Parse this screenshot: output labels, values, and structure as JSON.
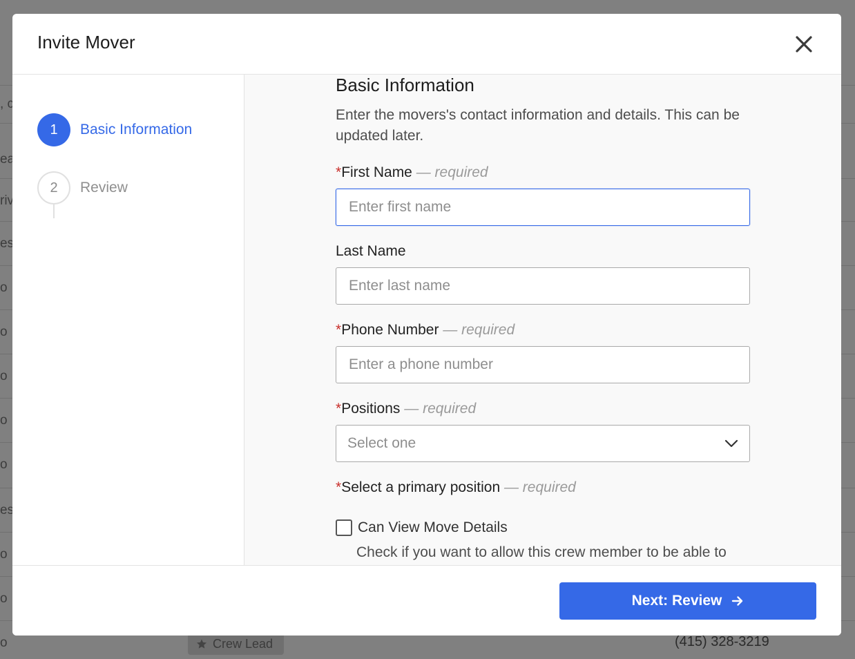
{
  "background": {
    "edge_fragments": [
      ", c",
      "ea",
      "riv",
      "es",
      "o",
      "o",
      "o",
      "o",
      "o",
      "es",
      "o",
      "o",
      "o"
    ],
    "badge_label": "Crew Lead",
    "badge_icon": "star-icon",
    "phone": "(415) 328-3219"
  },
  "modal": {
    "title": "Invite Mover",
    "close_icon": "close-icon"
  },
  "steps": [
    {
      "number": "1",
      "label": "Basic Information",
      "state": "active"
    },
    {
      "number": "2",
      "label": "Review",
      "state": "inactive"
    }
  ],
  "form": {
    "section_title": "Basic Information",
    "section_description": "Enter the movers's contact information and details. This can be updated later.",
    "required_note": "— required",
    "first_name": {
      "label": "First Name",
      "placeholder": "Enter first name",
      "value": ""
    },
    "last_name": {
      "label": "Last Name",
      "placeholder": "Enter last name",
      "value": ""
    },
    "phone": {
      "label": "Phone Number",
      "placeholder": "Enter a phone number",
      "value": ""
    },
    "positions": {
      "label": "Positions",
      "selected": "Select one"
    },
    "primary_position": {
      "label": "Select a primary position"
    },
    "can_view": {
      "label": "Can View Move Details",
      "checked": false,
      "description": "Check if you want to allow this crew member to be able to"
    }
  },
  "footer": {
    "next_label": "Next: Review"
  },
  "colors": {
    "accent": "#3569e7",
    "required": "#c9302c"
  }
}
